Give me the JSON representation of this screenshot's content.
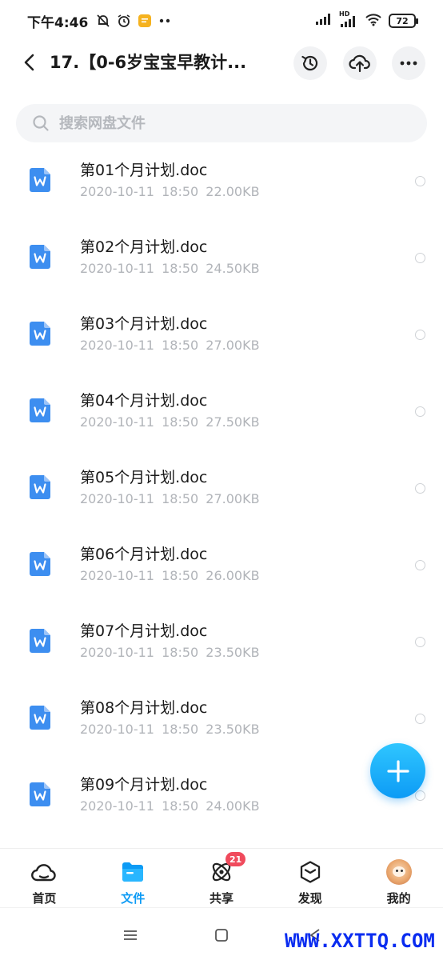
{
  "status_bar": {
    "time": "下午4:46",
    "hd_label": "HD",
    "battery": "72"
  },
  "header": {
    "title": "17.【0-6岁宝宝早教计..."
  },
  "search": {
    "placeholder": "搜索网盘文件"
  },
  "files": [
    {
      "name": "第01个月计划.doc",
      "date": "2020-10-11",
      "time": "18:50",
      "size": "22.00KB"
    },
    {
      "name": "第02个月计划.doc",
      "date": "2020-10-11",
      "time": "18:50",
      "size": "24.50KB"
    },
    {
      "name": "第03个月计划.doc",
      "date": "2020-10-11",
      "time": "18:50",
      "size": "27.00KB"
    },
    {
      "name": "第04个月计划.doc",
      "date": "2020-10-11",
      "time": "18:50",
      "size": "27.50KB"
    },
    {
      "name": "第05个月计划.doc",
      "date": "2020-10-11",
      "time": "18:50",
      "size": "27.00KB"
    },
    {
      "name": "第06个月计划.doc",
      "date": "2020-10-11",
      "time": "18:50",
      "size": "26.00KB"
    },
    {
      "name": "第07个月计划.doc",
      "date": "2020-10-11",
      "time": "18:50",
      "size": "23.50KB"
    },
    {
      "name": "第08个月计划.doc",
      "date": "2020-10-11",
      "time": "18:50",
      "size": "23.50KB"
    },
    {
      "name": "第09个月计划.doc",
      "date": "2020-10-11",
      "time": "18:50",
      "size": "24.00KB"
    }
  ],
  "bottom_nav": {
    "tabs": [
      {
        "label": "首页",
        "icon": "cloud-home-icon"
      },
      {
        "label": "文件",
        "icon": "folder-icon",
        "active": true
      },
      {
        "label": "共享",
        "icon": "atom-share-icon",
        "badge": "21"
      },
      {
        "label": "发现",
        "icon": "cube-discover-icon"
      },
      {
        "label": "我的",
        "icon": "avatar"
      }
    ]
  },
  "watermark": "WWW.XXTTQ.COM",
  "colors": {
    "accent": "#0d9bf5",
    "file_icon": "#3d8ef0",
    "badge": "#f04a5c",
    "meta_text": "#b1b4b9",
    "watermark": "#0a2cf0"
  }
}
